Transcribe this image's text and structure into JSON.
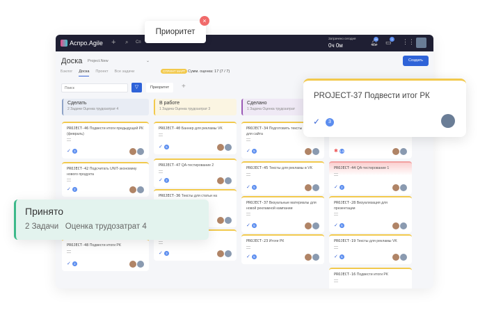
{
  "app": {
    "name": "Аспро.Agile",
    "time_label": "Затрачено сегодня",
    "time_value": "0ч 0м",
    "notif_count": "26",
    "msg_count": "3",
    "search": "Сп"
  },
  "page": {
    "title": "Доска",
    "project": "Project.New",
    "create": "Создать",
    "tabs": [
      "Бэклог",
      "Доска",
      "Проект",
      "Все задачи"
    ],
    "sprint_badge": "СПРИНТ МАРТ",
    "sum_label": "Сумм. оценка: 17 (7 / 7)",
    "search_placeholder": "Поиск",
    "filter_chip": "Приоритет"
  },
  "columns": [
    {
      "title": "Сделать",
      "sub": "2 Задачи  Оценка трудозатрат 4",
      "color": "#8fa3c7",
      "bg": "#e8ecf4"
    },
    {
      "title": "В работе",
      "sub": "1 Задача  Оценка трудозатрат 3",
      "color": "#f2c94c",
      "bg": "#fbf5e2"
    },
    {
      "title": "Сделано",
      "sub": "1 Задача  Оценка трудозатрат",
      "color": "#9b59b6",
      "bg": "#efe9f5"
    }
  ],
  "cards": [
    {
      "id": "PROJECT-46",
      "title": "Подвести итоги предыдущей РК (февраль)",
      "est": "3"
    },
    {
      "id": "PROJECT-42",
      "title": "Подсчитать UNIT-экономику нового продукта",
      "est": "2"
    },
    {
      "id": "PROJECT-48",
      "title": "Подвести итоги РК",
      "est": "2"
    },
    {
      "id": "PROJECT-40",
      "title": "Баннер для рекламы VK",
      "est": "5"
    },
    {
      "id": "PROJECT-47",
      "title": "QA-тестирование 2",
      "est": "2"
    },
    {
      "id": "PROJECT-36",
      "title": "Тексты для статьи на",
      "est": ""
    },
    {
      "id": "",
      "title": "теории",
      "est": "3"
    },
    {
      "id": "PROJECT-34",
      "title": "Подготовить тексты картинки для сайта",
      "est": "5"
    },
    {
      "id": "PROJECT-45",
      "title": "Тексты для рекламы в VK",
      "est": "5"
    },
    {
      "id": "PROJECT-37",
      "title": "Визуальные материалы для новой рекламной кампании",
      "est": "5"
    },
    {
      "id": "PROJECT-23",
      "title": "Итоги РК",
      "est": "5"
    },
    {
      "id": "",
      "title": "",
      "est": "1.5"
    },
    {
      "id": "PROJECT-44",
      "title": "QA-тестирование 1",
      "est": "2"
    },
    {
      "id": "PROJECT-28",
      "title": "Визуализация для презентации",
      "est": "5"
    },
    {
      "id": "PROJECT-19",
      "title": "Тексты для рекламы VK",
      "est": "5"
    },
    {
      "id": "PROJECT-16",
      "title": "Подвести итоги РК",
      "est": ""
    }
  ],
  "popup_card": {
    "text": "PROJECT-37 Подвести итог РК",
    "est": "3"
  },
  "popup_column": {
    "title": "Принято",
    "sub": "2 Задачи   Оценка трудозатрат 4"
  },
  "tooltip": {
    "text": "Приоритет"
  }
}
